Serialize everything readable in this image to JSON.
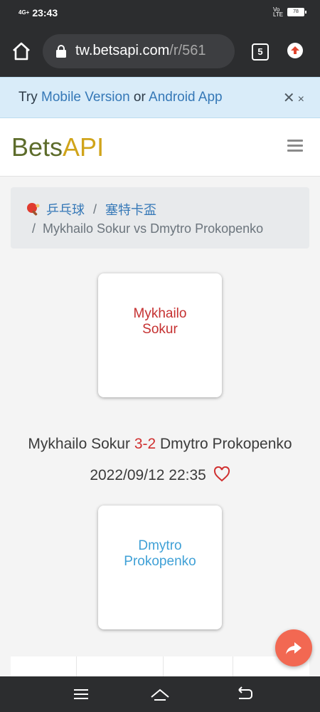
{
  "status_bar": {
    "time": "23:43",
    "network": "4G+",
    "battery": "78",
    "volte": "Vo LTE"
  },
  "browser": {
    "url_domain": "tw.betsapi.com",
    "url_path": "/r/561",
    "tab_count": "5",
    "icons": [
      "home-icon",
      "lock-icon",
      "tabs-icon",
      "update-icon"
    ]
  },
  "banner": {
    "prefix": "Try ",
    "mobile_link": "Mobile Version",
    "middle": " or ",
    "app_link": "Android App",
    "close_symbol": "✕",
    "close_symbol_small": "×"
  },
  "header": {
    "logo_part1": "Bets",
    "logo_part2": "API",
    "logo_colors": {
      "bets": "#5d6c2b",
      "api": "#d0a41a"
    }
  },
  "breadcrumb": {
    "sport": "乒乓球",
    "separator": "/",
    "league": "塞特卡盃",
    "current": "Mykhailo Sokur vs Dmytro Prokopenko"
  },
  "match": {
    "home_team": "Mykhailo Sokur",
    "away_team": "Dmytro Prokopenko",
    "home_team_card_line1": "Mykhailo",
    "home_team_card_line2": "Sokur",
    "away_team_card_line1": "Dmytro",
    "away_team_card_line2": "Prokopenko",
    "score": "3-2",
    "datetime": "2022/09/12 22:35",
    "colors": {
      "home": "#c53030",
      "away": "#3fa0d6",
      "score": "#d03030"
    }
  }
}
